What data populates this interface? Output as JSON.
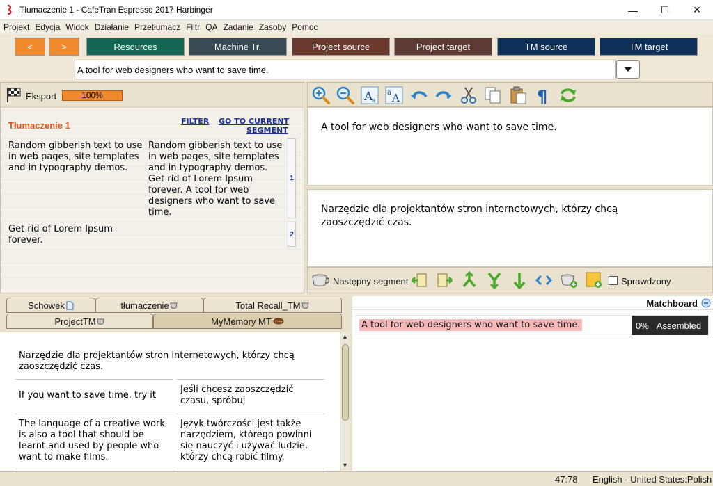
{
  "window": {
    "title": "Tłumaczenie 1 - CafeTran Espresso 2017 Harbinger",
    "controls": {
      "minimize": "—",
      "maximize": "☐",
      "close": "✕"
    }
  },
  "menu": [
    "Projekt",
    "Edycja",
    "Widok",
    "Działanie",
    "Przetłumacz",
    "Filtr",
    "QA",
    "Zadanie",
    "Zasoby",
    "Pomoc"
  ],
  "toolbar": {
    "prev": "<",
    "next": ">",
    "buttons": [
      {
        "label": "Resources",
        "color": "#136752"
      },
      {
        "label": "Machine Tr.",
        "color": "#3a4a54"
      },
      {
        "label": "Project source",
        "color": "#6a3a2e"
      },
      {
        "label": "Project target",
        "color": "#5e3a34"
      },
      {
        "label": "TM source",
        "color": "#0d2f58"
      },
      {
        "label": "TM target",
        "color": "#0d2f58"
      }
    ],
    "accent": "#f08a2c"
  },
  "search": {
    "value": "A tool for web designers who want to save time."
  },
  "project_panel": {
    "export_label": "Eksport",
    "progress": "100%",
    "title": "Tłumaczenie 1",
    "filter_link": "FILTER",
    "goto_link_line1": "GO TO CURRENT",
    "goto_link_line2": "SEGMENT",
    "segments": [
      {
        "number": "1",
        "source_lines": [
          "Random gibberish text to use",
          "in web pages, site templates",
          "and in typography demos."
        ],
        "target_lines": [
          "Random gibberish text to use",
          "in web pages, site templates",
          "and in typography demos.",
          "Get rid of Lorem Ipsum",
          "forever. A tool for web",
          "designers who want to save",
          "time."
        ]
      },
      {
        "number": "2",
        "source_lines": [
          "Get rid of Lorem Ipsum",
          "forever."
        ],
        "target_lines": []
      }
    ]
  },
  "editor": {
    "source": "A tool for web designers who want to save time.",
    "target_lines": [
      "Narzędzie dla projektantów stron internetowych, którzy chcą",
      "zaoszczędzić czas."
    ]
  },
  "nav": {
    "next_segment": "Następny segment",
    "checked": "Sprawdzony"
  },
  "tabs_row1": [
    "Schowek",
    "tłumaczenie",
    "Total Recall_TM"
  ],
  "tabs_row2": [
    "ProjectTM",
    "MyMemory MT"
  ],
  "tm_results": {
    "top_lines": [
      "Narzędzie dla projektantów stron internetowych, którzy chcą",
      "zaoszczędzić czas."
    ],
    "pairs": [
      {
        "source_lines": [
          "If you want to save time, try it"
        ],
        "target_lines": [
          "Jeśli chcesz zaoszczędzić",
          "czasu, spróbuj"
        ]
      },
      {
        "source_lines": [
          "The language of a creative work",
          "is also a tool that should be",
          "learnt and used by people who",
          "want to make films."
        ],
        "target_lines": [
          "Język twórczości jest także",
          "narzędziem, którego powinni",
          "się nauczyć i używać ludzie,",
          "którzy chcą robić filmy."
        ]
      }
    ]
  },
  "matchboard": {
    "label": "Matchboard",
    "match_text": "A tool for web designers who want to save time.",
    "percent": "0%",
    "status": "Assembled"
  },
  "status": {
    "position": "47:78",
    "language": "English - United States:Polish"
  }
}
